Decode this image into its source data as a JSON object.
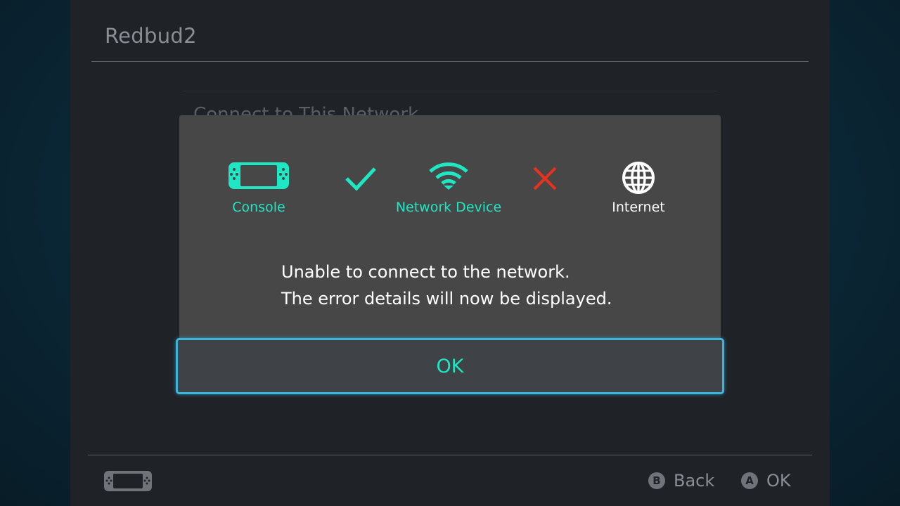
{
  "screen": {
    "title": "Redbud2",
    "menu_item": "Connect to This Network",
    "footer": {
      "back_key": "B",
      "back_label": "Back",
      "ok_key": "A",
      "ok_label": "OK"
    }
  },
  "dialog": {
    "console_label": "Console",
    "device_label": "Network Device",
    "internet_label": "Internet",
    "message_line1": "Unable to connect to the network.",
    "message_line2": "The error details will now be displayed.",
    "ok_label": "OK",
    "icons": [
      "console-icon",
      "check-icon",
      "wifi-icon",
      "x-icon",
      "globe-icon"
    ]
  },
  "colors": {
    "accent_teal": "#1ee8c4",
    "error_red": "#e8321e",
    "focus_blue": "#3cb6dd",
    "dialog_bg": "#474747",
    "screen_bg": "#1f2227"
  }
}
